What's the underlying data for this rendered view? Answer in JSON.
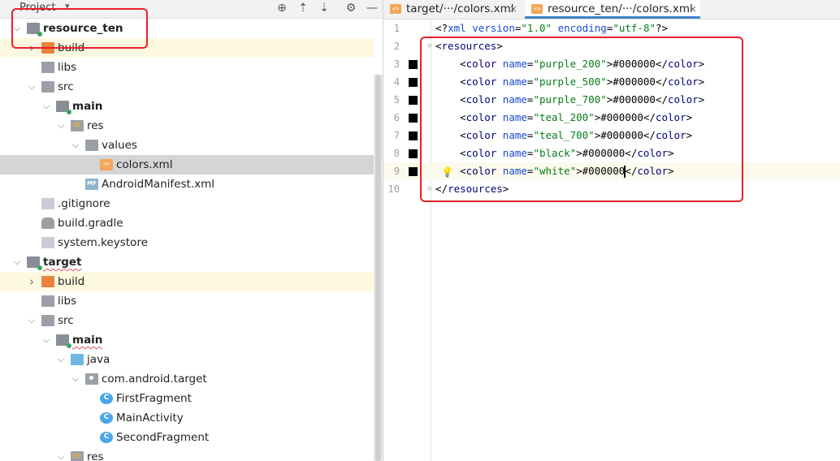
{
  "project_panel": {
    "title": "Project",
    "caret": "▾",
    "buttons": [
      {
        "name": "locate-icon",
        "glyph": "⊕"
      },
      {
        "name": "expand-all-icon",
        "glyph": "⇡"
      },
      {
        "name": "collapse-all-icon",
        "glyph": "⇣"
      },
      {
        "name": "settings-gear-icon",
        "glyph": "⚙"
      },
      {
        "name": "hide-panel-icon",
        "glyph": "—"
      }
    ],
    "tree": [
      {
        "label": "resource_ten",
        "bold": true,
        "icon": "module",
        "expanded": true
      },
      {
        "label": "build",
        "icon": "folder-orange",
        "expanded": false
      },
      {
        "label": "libs",
        "icon": "folder-gray"
      },
      {
        "label": "src",
        "icon": "folder-gray",
        "expanded": true
      },
      {
        "label": "main",
        "bold": true,
        "icon": "module",
        "expanded": true
      },
      {
        "label": "res",
        "icon": "folder-res",
        "expanded": true
      },
      {
        "label": "values",
        "icon": "folder-gray",
        "expanded": true
      },
      {
        "label": "colors.xml",
        "icon": "xml",
        "selected": true
      },
      {
        "label": "AndroidManifest.xml",
        "icon": "manifest",
        "icon_text": "MF"
      },
      {
        "label": ".gitignore",
        "icon": "file"
      },
      {
        "label": "build.gradle",
        "icon": "gradle"
      },
      {
        "label": "system.keystore",
        "icon": "file"
      },
      {
        "label": "target",
        "bold": true,
        "icon": "module",
        "expanded": true
      },
      {
        "label": "build",
        "icon": "folder-orange",
        "expanded": false
      },
      {
        "label": "libs",
        "icon": "folder-gray"
      },
      {
        "label": "src",
        "icon": "folder-gray",
        "expanded": true
      },
      {
        "label": "main",
        "bold": true,
        "icon": "module",
        "expanded": true
      },
      {
        "label": "java",
        "icon": "folder-blue",
        "expanded": true
      },
      {
        "label": "com.android.target",
        "icon": "package",
        "expanded": true
      },
      {
        "label": "FirstFragment",
        "icon": "class",
        "icon_text": "C"
      },
      {
        "label": "MainActivity",
        "icon": "class",
        "icon_text": "C"
      },
      {
        "label": "SecondFragment",
        "icon": "class",
        "icon_text": "C"
      },
      {
        "label": "res",
        "icon": "folder-res",
        "expanded": true
      }
    ]
  },
  "editor": {
    "tabs": [
      {
        "label": "target/···/colors.xml",
        "active": false,
        "close": "×"
      },
      {
        "label": "resource_ten/···/colors.xml",
        "active": true,
        "close": "×"
      }
    ],
    "lines": [
      {
        "num": "1",
        "tokens": [
          {
            "c": "t-txt",
            "t": "<?"
          },
          {
            "c": "t-attr",
            "t": "xml version"
          },
          {
            "c": "t-txt",
            "t": "="
          },
          {
            "c": "t-val",
            "t": "\"1.0\""
          },
          {
            "c": "t-txt",
            "t": " "
          },
          {
            "c": "t-attr",
            "t": "encoding"
          },
          {
            "c": "t-txt",
            "t": "="
          },
          {
            "c": "t-val",
            "t": "\"utf-8\""
          },
          {
            "c": "t-txt",
            "t": "?>"
          }
        ]
      },
      {
        "num": "2",
        "fold": "⊖",
        "tokens": [
          {
            "c": "t-txt",
            "t": "<"
          },
          {
            "c": "t-tag",
            "t": "resources"
          },
          {
            "c": "t-txt",
            "t": ">"
          }
        ]
      },
      {
        "num": "3",
        "swatch": "#000000",
        "tokens": [
          {
            "c": "t-txt",
            "t": "    <"
          },
          {
            "c": "t-tag",
            "t": "color "
          },
          {
            "c": "t-attr",
            "t": "name"
          },
          {
            "c": "t-txt",
            "t": "="
          },
          {
            "c": "t-val",
            "t": "\"purple_200\""
          },
          {
            "c": "t-txt",
            "t": ">#000000</"
          },
          {
            "c": "t-tag",
            "t": "color"
          },
          {
            "c": "t-txt",
            "t": ">"
          }
        ]
      },
      {
        "num": "4",
        "swatch": "#000000",
        "tokens": [
          {
            "c": "t-txt",
            "t": "    <"
          },
          {
            "c": "t-tag",
            "t": "color "
          },
          {
            "c": "t-attr",
            "t": "name"
          },
          {
            "c": "t-txt",
            "t": "="
          },
          {
            "c": "t-val",
            "t": "\"purple_500\""
          },
          {
            "c": "t-txt",
            "t": ">#000000</"
          },
          {
            "c": "t-tag",
            "t": "color"
          },
          {
            "c": "t-txt",
            "t": ">"
          }
        ]
      },
      {
        "num": "5",
        "swatch": "#000000",
        "tokens": [
          {
            "c": "t-txt",
            "t": "    <"
          },
          {
            "c": "t-tag",
            "t": "color "
          },
          {
            "c": "t-attr",
            "t": "name"
          },
          {
            "c": "t-txt",
            "t": "="
          },
          {
            "c": "t-val",
            "t": "\"purple_700\""
          },
          {
            "c": "t-txt",
            "t": ">#000000</"
          },
          {
            "c": "t-tag",
            "t": "color"
          },
          {
            "c": "t-txt",
            "t": ">"
          }
        ]
      },
      {
        "num": "6",
        "swatch": "#000000",
        "tokens": [
          {
            "c": "t-txt",
            "t": "    <"
          },
          {
            "c": "t-tag",
            "t": "color "
          },
          {
            "c": "t-attr",
            "t": "name"
          },
          {
            "c": "t-txt",
            "t": "="
          },
          {
            "c": "t-val",
            "t": "\"teal_200\""
          },
          {
            "c": "t-txt",
            "t": ">#000000</"
          },
          {
            "c": "t-tag",
            "t": "color"
          },
          {
            "c": "t-txt",
            "t": ">"
          }
        ]
      },
      {
        "num": "7",
        "swatch": "#000000",
        "tokens": [
          {
            "c": "t-txt",
            "t": "    <"
          },
          {
            "c": "t-tag",
            "t": "color "
          },
          {
            "c": "t-attr",
            "t": "name"
          },
          {
            "c": "t-txt",
            "t": "="
          },
          {
            "c": "t-val",
            "t": "\"teal_700\""
          },
          {
            "c": "t-txt",
            "t": ">#000000</"
          },
          {
            "c": "t-tag",
            "t": "color"
          },
          {
            "c": "t-txt",
            "t": ">"
          }
        ]
      },
      {
        "num": "8",
        "swatch": "#000000",
        "tokens": [
          {
            "c": "t-txt",
            "t": "    <"
          },
          {
            "c": "t-tag",
            "t": "color "
          },
          {
            "c": "t-attr",
            "t": "name"
          },
          {
            "c": "t-txt",
            "t": "="
          },
          {
            "c": "t-val",
            "t": "\"black\""
          },
          {
            "c": "t-txt",
            "t": ">#000000</"
          },
          {
            "c": "t-tag",
            "t": "color"
          },
          {
            "c": "t-txt",
            "t": ">"
          }
        ]
      },
      {
        "num": "9",
        "swatch": "#000000",
        "current": true,
        "bulb": true,
        "tokens": [
          {
            "c": "t-txt",
            "t": "    <"
          },
          {
            "c": "t-tag",
            "t": "color "
          },
          {
            "c": "t-attr",
            "t": "name"
          },
          {
            "c": "t-txt",
            "t": "="
          },
          {
            "c": "t-val",
            "t": "\"white\""
          },
          {
            "c": "t-txt",
            "t": ">#000000</"
          },
          {
            "c": "t-tag",
            "t": "color"
          },
          {
            "c": "t-txt",
            "t": ">"
          }
        ]
      },
      {
        "num": "10",
        "fold": "⊖",
        "tokens": [
          {
            "c": "t-txt",
            "t": "</"
          },
          {
            "c": "t-tag",
            "t": "resources"
          },
          {
            "c": "t-txt",
            "t": ">"
          }
        ]
      }
    ]
  },
  "colors": {
    "annotation_red": "#e8202a",
    "selection_gray": "#d5d5d5",
    "highlight_yellow": "#fdf8e0",
    "tab_underline": "#4083c9"
  }
}
